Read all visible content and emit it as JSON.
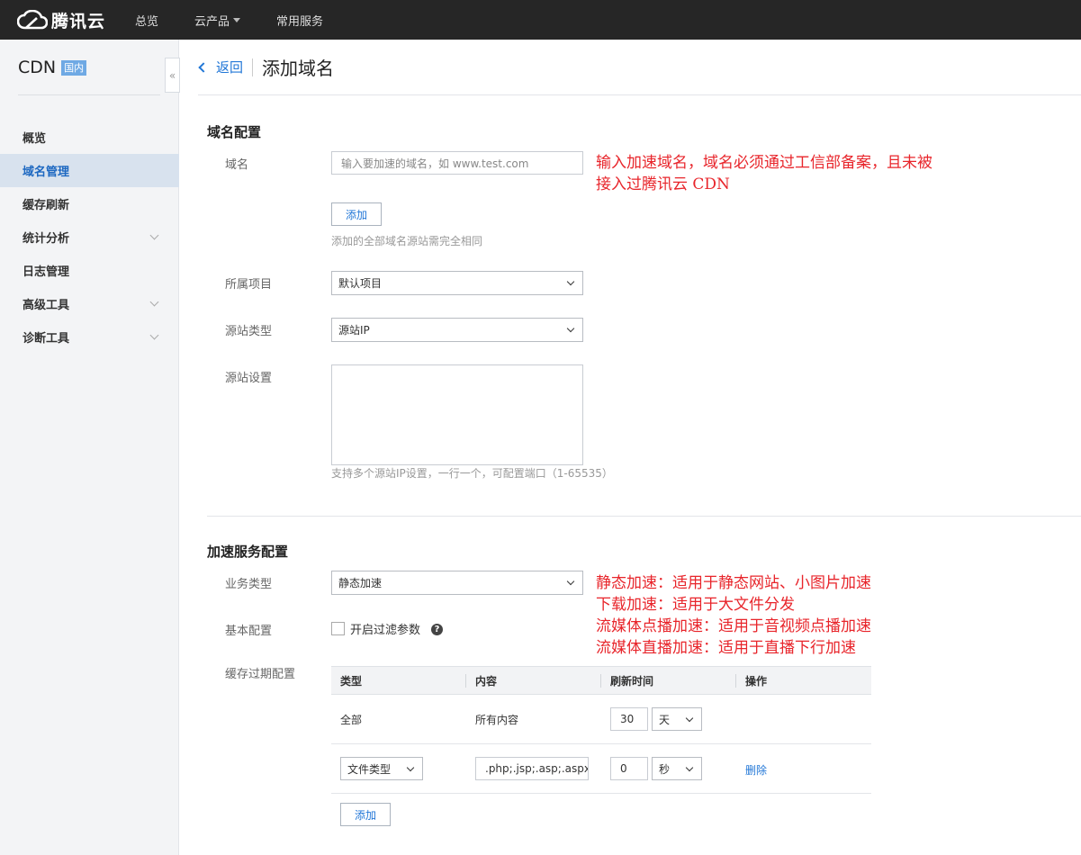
{
  "topbar": {
    "brand": "腾讯云",
    "nav": [
      {
        "label": "总览"
      },
      {
        "label": "云产品",
        "has_dropdown": true
      },
      {
        "label": "常用服务"
      }
    ]
  },
  "sidebar": {
    "title": "CDN",
    "badge": "国内",
    "collapse_glyph": "«",
    "items": [
      {
        "label": "概览",
        "expandable": false,
        "active": false
      },
      {
        "label": "域名管理",
        "expandable": false,
        "active": true
      },
      {
        "label": "缓存刷新",
        "expandable": false,
        "active": false
      },
      {
        "label": "统计分析",
        "expandable": true,
        "active": false
      },
      {
        "label": "日志管理",
        "expandable": false,
        "active": false
      },
      {
        "label": "高级工具",
        "expandable": true,
        "active": false
      },
      {
        "label": "诊断工具",
        "expandable": true,
        "active": false
      }
    ]
  },
  "header": {
    "back_label": "返回",
    "title": "添加域名"
  },
  "domain_config": {
    "section_title": "域名配置",
    "domain_label": "域名",
    "domain_placeholder": "输入要加速的域名，如 www.test.com",
    "add_button": "添加",
    "add_hint": "添加的全部域名源站需完全相同",
    "project_label": "所属项目",
    "project_value": "默认项目",
    "origin_type_label": "源站类型",
    "origin_type_value": "源站IP",
    "origin_settings_label": "源站设置",
    "origin_hint": "支持多个源站IP设置，一行一个，可配置端口（1-65535）"
  },
  "annotation_domain": {
    "line1": "输入加速域名，域名必须通过工信部备案，且未被",
    "line2": "接入过腾讯云 CDN"
  },
  "accel_config": {
    "section_title": "加速服务配置",
    "business_type_label": "业务类型",
    "business_type_value": "静态加速",
    "basic_config_label": "基本配置",
    "filter_checkbox_label": "开启过滤参数",
    "cache_expire_label": "缓存过期配置"
  },
  "annotation_business": [
    "静态加速：适用于静态网站、小图片加速",
    "下载加速：适用于大文件分发",
    "流媒体点播加速：适用于音视频点播加速",
    "流媒体直播加速：适用于直播下行加速"
  ],
  "cache_table": {
    "headers": [
      "类型",
      "内容",
      "刷新时间",
      "操作"
    ],
    "rows": [
      {
        "type": "全部",
        "content": "所有内容",
        "time_value": "30",
        "time_unit": "天",
        "action": ""
      },
      {
        "type": "文件类型",
        "content": ".php;.jsp;.asp;.aspx",
        "time_value": "0",
        "time_unit": "秒",
        "action": "删除"
      }
    ],
    "add_button": "添加"
  },
  "colors": {
    "topbar_bg": "#262626",
    "accent_blue": "#2277d7",
    "annotation_red": "#e8252b",
    "sidebar_active_bg": "#d8e2ee"
  }
}
